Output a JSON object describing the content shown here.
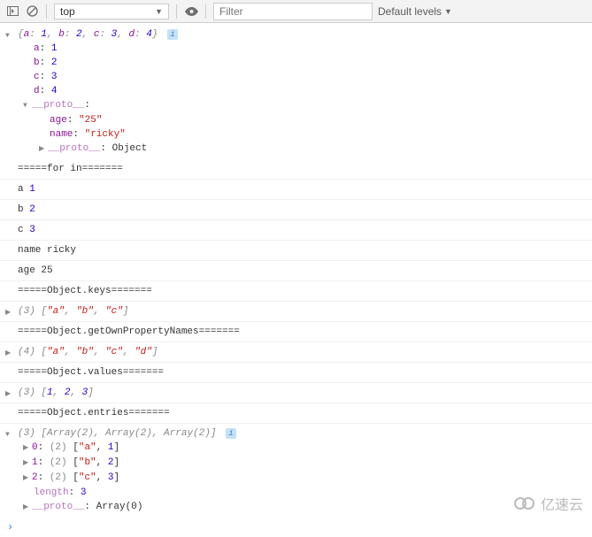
{
  "toolbar": {
    "context": "top",
    "filter_placeholder": "Filter",
    "levels": "Default levels"
  },
  "obj_preview": {
    "a": 1,
    "b": 2,
    "c": 3,
    "d": 4
  },
  "obj_props": [
    {
      "key": "a",
      "val": 1,
      "type": "num"
    },
    {
      "key": "b",
      "val": 2,
      "type": "num"
    },
    {
      "key": "c",
      "val": 3,
      "type": "num"
    },
    {
      "key": "d",
      "val": 4,
      "type": "num"
    }
  ],
  "proto_label": "__proto__",
  "proto_props": [
    {
      "key": "age",
      "val": "\"25\"",
      "type": "str"
    },
    {
      "key": "name",
      "val": "\"ricky\"",
      "type": "str"
    }
  ],
  "proto_nested": {
    "key": "__proto__",
    "val": "Object"
  },
  "sections": {
    "forin_header": "=====for in=======",
    "forin_lines": [
      "a 1",
      "b 2",
      "c 3",
      "name ricky",
      "age 25"
    ],
    "keys_header": "=====Object.keys=======",
    "keys_count": "(3)",
    "keys_items": [
      "\"a\"",
      "\"b\"",
      "\"c\""
    ],
    "ownprops_header": "=====Object.getOwnPropertyNames=======",
    "ownprops_count": "(4)",
    "ownprops_items": [
      "\"a\"",
      "\"b\"",
      "\"c\"",
      "\"d\""
    ],
    "values_header": "=====Object.values=======",
    "values_count": "(3)",
    "values_items": [
      1,
      2,
      3
    ],
    "entries_header": "=====Object.entries=======",
    "entries_count": "(3)",
    "entries_preview": "[Array(2), Array(2), Array(2)]",
    "entries": [
      {
        "idx": 0,
        "len": "(2)",
        "k": "\"a\"",
        "v": 1
      },
      {
        "idx": 1,
        "len": "(2)",
        "k": "\"b\"",
        "v": 2
      },
      {
        "idx": 2,
        "len": "(2)",
        "k": "\"c\"",
        "v": 3
      }
    ],
    "entries_length": {
      "key": "length",
      "val": 3
    },
    "entries_proto": {
      "key": "__proto__",
      "val": "Array(0)"
    }
  },
  "watermark": "亿速云"
}
